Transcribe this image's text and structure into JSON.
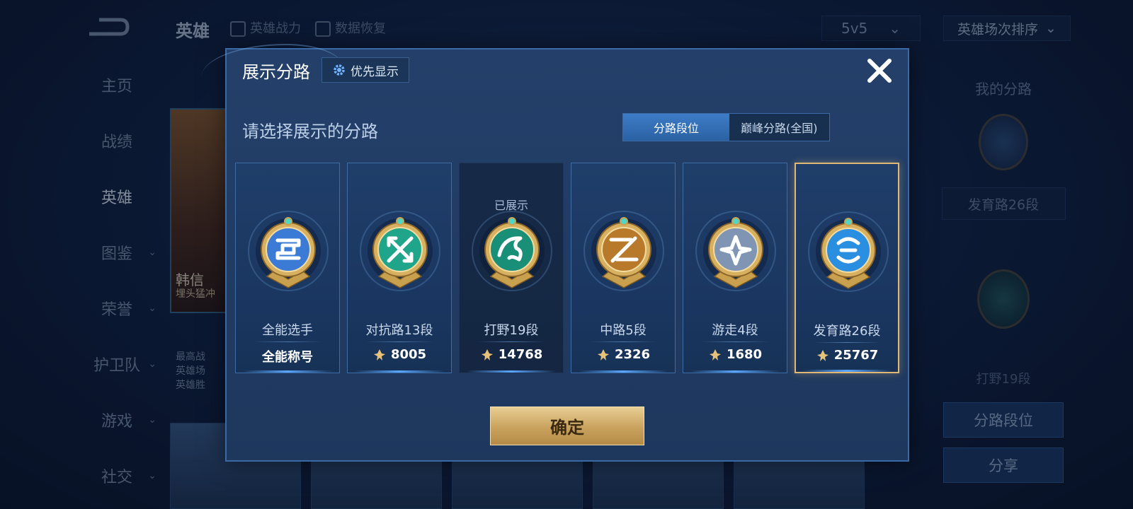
{
  "background": {
    "nav_items": [
      {
        "label": "主页",
        "chevron": false,
        "active": false
      },
      {
        "label": "战绩",
        "chevron": false,
        "active": false
      },
      {
        "label": "英雄",
        "chevron": false,
        "active": true
      },
      {
        "label": "图鉴",
        "chevron": true,
        "active": false
      },
      {
        "label": "荣誉",
        "chevron": true,
        "active": false
      },
      {
        "label": "护卫队",
        "chevron": true,
        "active": false
      },
      {
        "label": "游戏",
        "chevron": true,
        "active": false
      },
      {
        "label": "社交",
        "chevron": true,
        "active": false
      }
    ],
    "chevron": "⌄",
    "page_title": "英雄",
    "link_hero_power": "英雄战力",
    "link_data_restore": "数据恢复",
    "mode_select": "5v5",
    "sort_select": "英雄场次排序",
    "select_arrow": "⌄",
    "hero_name": "韩信",
    "hero_sub": "埋头猛冲",
    "hero_info": [
      "最高战",
      "英雄场",
      "英雄胜"
    ],
    "right_title": "我的分路",
    "right_lane1": "发育路26段",
    "right_lane2": "打野19段",
    "right_btn_lane": "分路段位",
    "right_btn_share": "分享"
  },
  "modal": {
    "title": "展示分路",
    "priority_label": "优先显示",
    "prompt": "请选择展示的分路",
    "tabs": [
      "分路段位",
      "巅峰分路(全国)"
    ],
    "active_tab": 0,
    "cards": [
      {
        "lane": "全能选手",
        "power": "全能称号",
        "power_icon": false,
        "shown": "",
        "badge": "allround",
        "color": "#3b7bd6"
      },
      {
        "lane": "对抗路13段",
        "power": "8005",
        "power_icon": true,
        "shown": "",
        "badge": "clash",
        "color": "#1fa68a"
      },
      {
        "lane": "打野19段",
        "power": "14768",
        "power_icon": true,
        "shown": "已展示",
        "badge": "jungle",
        "color": "#1a8f78"
      },
      {
        "lane": "中路5段",
        "power": "2326",
        "power_icon": true,
        "shown": "",
        "badge": "mid",
        "color": "#b87a2a"
      },
      {
        "lane": "游走4段",
        "power": "1680",
        "power_icon": true,
        "shown": "",
        "badge": "roam",
        "color": "#7f95b3"
      },
      {
        "lane": "发育路26段",
        "power": "25767",
        "power_icon": true,
        "shown": "",
        "badge": "farm",
        "color": "#2a8fe0"
      }
    ],
    "selected_card": 5,
    "confirm_label": "确定"
  }
}
